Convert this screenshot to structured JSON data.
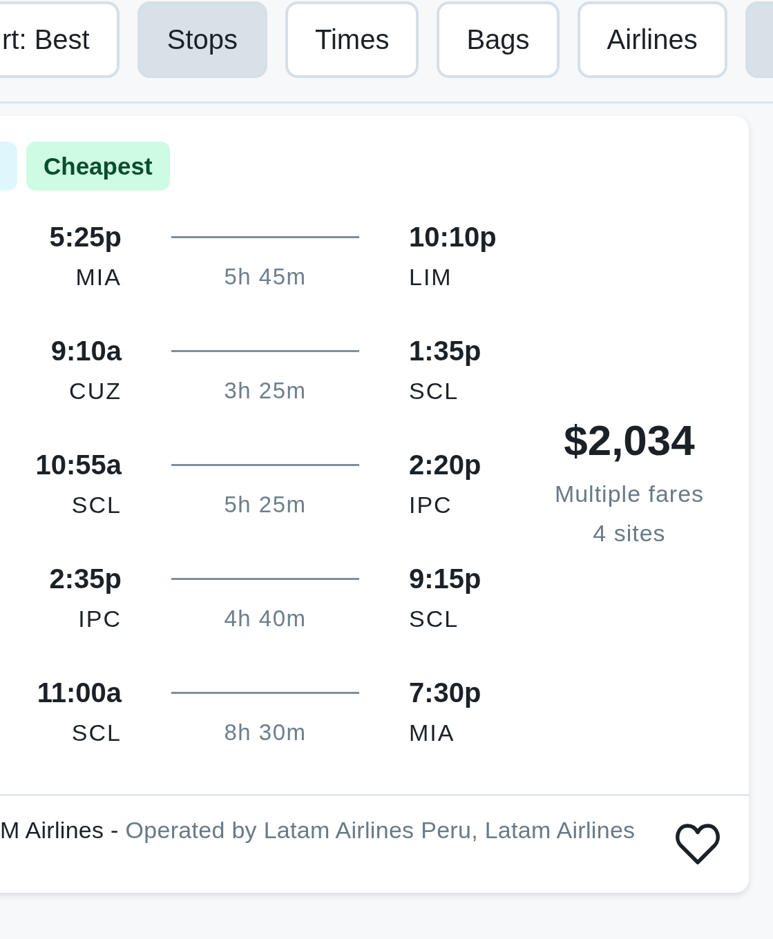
{
  "filters": [
    {
      "label": "rt: Best",
      "selected": false
    },
    {
      "label": "Stops",
      "selected": true
    },
    {
      "label": "Times",
      "selected": false
    },
    {
      "label": "Bags",
      "selected": false
    },
    {
      "label": "Airlines",
      "selected": false
    },
    {
      "selected": true
    }
  ],
  "result": {
    "tags": [
      {
        "kind": "info"
      },
      {
        "kind": "cheapest",
        "label": "Cheapest"
      }
    ],
    "legs": [
      {
        "depart_time": "5:25p",
        "depart_airport": "MIA",
        "duration": "5h 45m",
        "arrive_time": "10:10p",
        "arrive_airport": "LIM"
      },
      {
        "depart_time": "9:10a",
        "depart_airport": "CUZ",
        "duration": "3h 25m",
        "arrive_time": "1:35p",
        "arrive_airport": "SCL"
      },
      {
        "depart_time": "10:55a",
        "depart_airport": "SCL",
        "duration": "5h 25m",
        "arrive_time": "2:20p",
        "arrive_airport": "IPC"
      },
      {
        "depart_time": "2:35p",
        "depart_airport": "IPC",
        "duration": "4h 40m",
        "arrive_time": "9:15p",
        "arrive_airport": "SCL"
      },
      {
        "depart_time": "11:00a",
        "depart_airport": "SCL",
        "duration": "8h 30m",
        "arrive_time": "7:30p",
        "arrive_airport": "MIA"
      }
    ],
    "price": "$2,034",
    "fare_note": "Multiple fares",
    "sites": "4 sites",
    "airline": "M Airlines -",
    "operated_by": "Operated by Latam Airlines Peru, Latam Airlines",
    "saved": false
  }
}
